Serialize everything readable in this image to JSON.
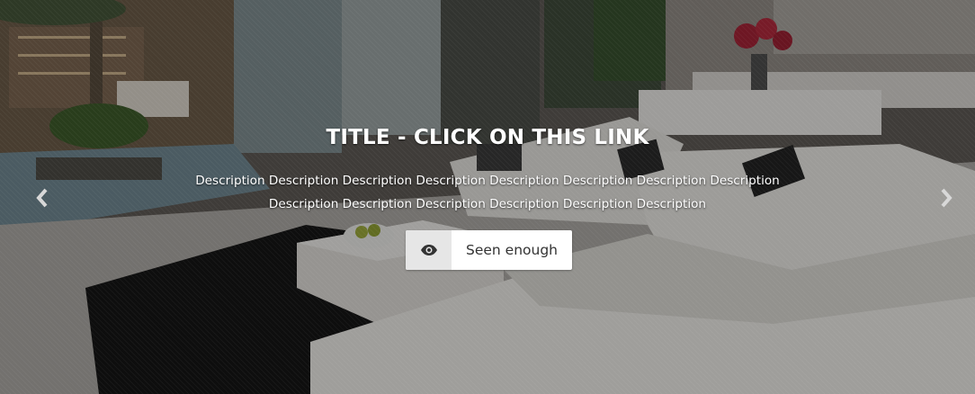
{
  "slide": {
    "title": "TITLE - CLICK ON THIS LINK",
    "description": "Description Description Description Description Description Description Description Description Description Description Description Description Description Description",
    "button_label": "Seen enough",
    "button_icon": "eye-icon"
  },
  "controls": {
    "prev_icon": "chevron-left-icon",
    "next_icon": "chevron-right-icon"
  },
  "colors": {
    "overlay": "#000000",
    "text": "#ffffff",
    "button_bg": "#ffffff",
    "button_icon_bg": "#e6e6e6",
    "button_text": "#333333"
  }
}
